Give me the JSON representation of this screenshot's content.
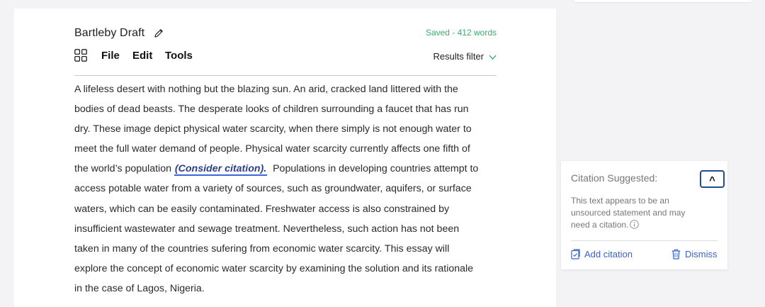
{
  "document": {
    "title": "Bartleby Draft",
    "save_status": "Saved - 412 words",
    "menu": {
      "file": "File",
      "edit": "Edit",
      "tools": "Tools",
      "results_filter": "Results filter"
    },
    "lines": [
      "A lifeless desert with nothing but the blazing sun. An arid, cracked land littered with the",
      "bodies of dead beasts. The desperate looks of children surrounding a faucet that has run",
      "dry. These image depict physical water scarcity, when there simply is not enough water to",
      "meet the full water demand of people. Physical water scarcity currently affects one fifth of"
    ],
    "citation_line": {
      "before": "the world’s population ",
      "mark": "(Consider citation).",
      "after": "  Populations in developing countries attempt to"
    },
    "lines_after": [
      "access potable water from a variety of sources, such as groundwater, aquifers, or surface",
      "waters, which can be easily contaminated. Freshwater access is also constrained by",
      "insufficient wastewater and sewage treatment. Nevertheless, such action has not been",
      "taken in many of the countries sufering from economic water scarcity. This essay will",
      "explore the concept of economic water scarcity by examining the solution and its rationale",
      "in the case of Lagos, Nigeria."
    ]
  },
  "citation_card": {
    "heading": "Citation Suggested:",
    "collapse_label": "^",
    "description": "This text appears to be an unsourced statement and may need a citation.",
    "add_label": "Add citation",
    "dismiss_label": "Dismiss"
  },
  "icons": {
    "edit": "pencil-icon",
    "menu": "grid-icon",
    "filter": "chevron-down-icon",
    "info": "info-icon",
    "add": "add-citation-icon",
    "dismiss": "trash-icon"
  },
  "colors": {
    "saved": "#3aae6a",
    "link": "#3a63c8",
    "citation_underline": "#3b67d9",
    "collapse_border": "#1e4d91"
  }
}
